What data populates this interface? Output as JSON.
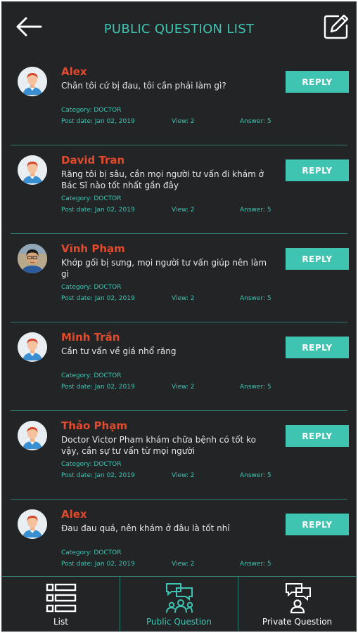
{
  "header": {
    "title": "PUBLIC QUESTION LIST"
  },
  "icons": {
    "back": "arrow-left-icon",
    "edit": "edit-compose-icon",
    "list": "list-icon",
    "public": "public-question-icon",
    "private": "private-question-icon"
  },
  "colors": {
    "background": "#222426",
    "accent": "#3fc4b2",
    "name": "#e24a2e",
    "divider": "#2f7d72"
  },
  "questions": [
    {
      "name": "Alex",
      "avatar": "default",
      "question": "Chân tôi cứ bị đau, tôi cần phải làm gì?",
      "category": "Category: DOCTOR",
      "date": "Post date: Jan 02, 2019",
      "views": "View: 2",
      "answers": "Answer: 5",
      "reply": "REPLY"
    },
    {
      "name": "David Tran",
      "avatar": "default",
      "question": "Răng tôi bị sâu, cần mọi người tư vấn đi khám ở Bác Sĩ nào tốt nhất gần đây",
      "category": "Category: DOCTOR",
      "date": "Post date: Jan 02, 2019",
      "views": "View: 2",
      "answers": "Answer: 5",
      "reply": "REPLY"
    },
    {
      "name": "Vĩnh Phạm",
      "avatar": "photo",
      "question": "Khớp gối bị sưng, mọi người tư vấn giúp nên làm gì",
      "category": "Category: DOCTOR",
      "date": "Post date: Jan 02, 2019",
      "views": "View: 2",
      "answers": "Answer: 5",
      "reply": "REPLY"
    },
    {
      "name": "Minh Trần",
      "avatar": "default",
      "question": "Cần tư vấn về giá nhổ răng",
      "category": "Category: DOCTOR",
      "date": "Post date: Jan 02, 2019",
      "views": "View: 2",
      "answers": "Answer: 5",
      "reply": "REPLY"
    },
    {
      "name": "Thảo Phạm",
      "avatar": "default",
      "question": "Doctor Victor Pham khám chữa bệnh có tốt ko vậy, cần sự tư vấn từ mọi người",
      "category": "Category: DOCTOR",
      "date": "Post date: Jan 02, 2019",
      "views": "View: 2",
      "answers": "Answer: 5",
      "reply": "REPLY"
    },
    {
      "name": "Alex",
      "avatar": "default",
      "question": "Đau đau quá, nên khám ở đâu là tốt nhỉ",
      "category": "Category: DOCTOR",
      "date": "Post date: Jan 02, 2019",
      "views": "View: 2",
      "answers": "Answer: 5",
      "reply": "REPLY"
    }
  ],
  "tabbar": {
    "list": "List",
    "public": "Public Question",
    "private": "Private Question",
    "active": "public"
  }
}
